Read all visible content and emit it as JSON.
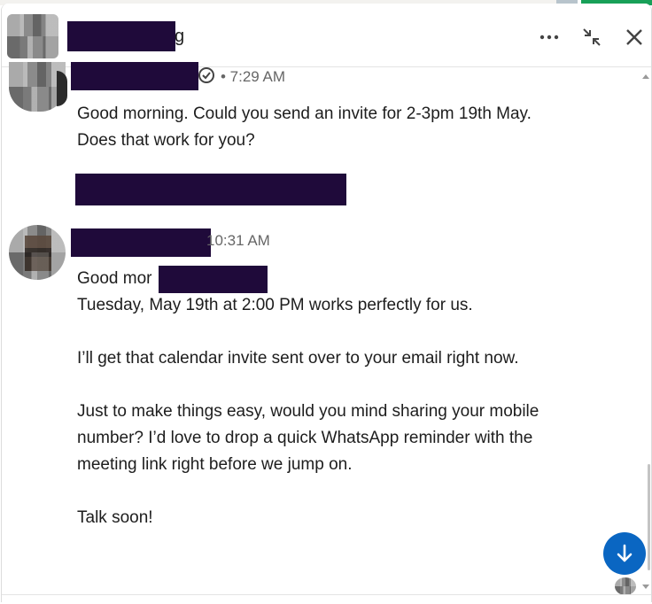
{
  "header": {
    "name_visible_tail": "g",
    "more_label": "...",
    "icons": {
      "more": "more-dots-icon",
      "collapse": "collapse-arrows-icon",
      "close": "close-icon"
    }
  },
  "messages": [
    {
      "time_text": "• 7:29 AM",
      "verified_icon": "verified-badge-icon",
      "text": "Good morning. Could you send an invite for 2-3pm 19th May. Does that work for you?"
    },
    {
      "time_text": "10:31 AM",
      "greeting_prefix": "Good mor",
      "line1": "Tuesday, May 19th at 2:00 PM works perfectly for us.",
      "para2": "I’ll get that calendar invite sent over to your email right now.",
      "para3": "Just to make things easy, would you mind sharing your mobile number? I’d love to drop a quick WhatsApp reminder with the meeting link right before we jump on.",
      "para4": "Talk soon!"
    }
  ],
  "jump_button_icon": "arrow-down-icon",
  "colors": {
    "accent": "#0a66c2",
    "redaction": "#1f0a3a"
  }
}
